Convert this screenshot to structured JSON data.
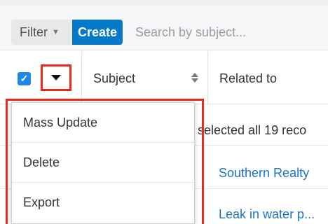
{
  "toolbar": {
    "filter_label": "Filter",
    "create_label": "Create",
    "search_placeholder": "Search by subject..."
  },
  "table": {
    "columns": [
      "Subject",
      "Related to"
    ],
    "select_all_checked": true
  },
  "actions_menu": {
    "items": [
      "Mass Update",
      "Delete",
      "Export"
    ]
  },
  "rows": {
    "notice_text": "selected all 19 reco",
    "related_links": [
      "Southern Realty",
      "Leak in water p..."
    ]
  },
  "colors": {
    "accent": "#0679c8",
    "highlight": "#e8291c",
    "link": "#1a73c7"
  }
}
